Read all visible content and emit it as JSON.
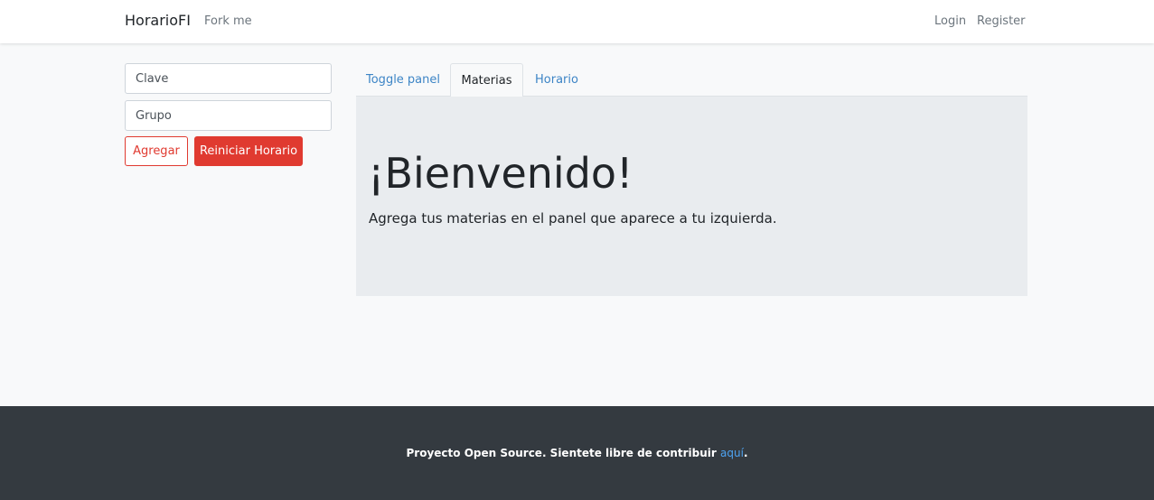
{
  "navbar": {
    "brand": "HorarioFI",
    "fork_label": "Fork me",
    "login_label": "Login",
    "register_label": "Register"
  },
  "form": {
    "clave_placeholder": "Clave",
    "grupo_placeholder": "Grupo",
    "agregar_label": "Agregar",
    "reiniciar_label": "Reiniciar Horario"
  },
  "tabs": [
    {
      "label": "Toggle panel"
    },
    {
      "label": "Materias"
    },
    {
      "label": "Horario"
    }
  ],
  "welcome": {
    "title": "¡Bienvenido!",
    "lead": "Agrega tus materias en el panel que aparece a tu izquierda."
  },
  "footer": {
    "text": "Proyecto Open Source. Sientete libre de contribuir ",
    "link_label": "aquí",
    "suffix": "."
  },
  "colors": {
    "accent": "#e03a30",
    "link": "#3d85c6",
    "footer_bg": "#343a40"
  }
}
